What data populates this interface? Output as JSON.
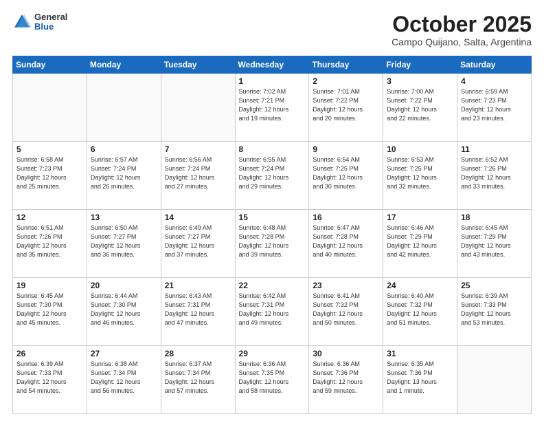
{
  "header": {
    "logo_general": "General",
    "logo_blue": "Blue",
    "title": "October 2025",
    "subtitle": "Campo Quijano, Salta, Argentina"
  },
  "weekdays": [
    "Sunday",
    "Monday",
    "Tuesday",
    "Wednesday",
    "Thursday",
    "Friday",
    "Saturday"
  ],
  "weeks": [
    [
      {
        "day": "",
        "info": ""
      },
      {
        "day": "",
        "info": ""
      },
      {
        "day": "",
        "info": ""
      },
      {
        "day": "1",
        "info": "Sunrise: 7:02 AM\nSunset: 7:21 PM\nDaylight: 12 hours\nand 19 minutes."
      },
      {
        "day": "2",
        "info": "Sunrise: 7:01 AM\nSunset: 7:22 PM\nDaylight: 12 hours\nand 20 minutes."
      },
      {
        "day": "3",
        "info": "Sunrise: 7:00 AM\nSunset: 7:22 PM\nDaylight: 12 hours\nand 22 minutes."
      },
      {
        "day": "4",
        "info": "Sunrise: 6:59 AM\nSunset: 7:23 PM\nDaylight: 12 hours\nand 23 minutes."
      }
    ],
    [
      {
        "day": "5",
        "info": "Sunrise: 6:58 AM\nSunset: 7:23 PM\nDaylight: 12 hours\nand 25 minutes."
      },
      {
        "day": "6",
        "info": "Sunrise: 6:57 AM\nSunset: 7:24 PM\nDaylight: 12 hours\nand 26 minutes."
      },
      {
        "day": "7",
        "info": "Sunrise: 6:56 AM\nSunset: 7:24 PM\nDaylight: 12 hours\nand 27 minutes."
      },
      {
        "day": "8",
        "info": "Sunrise: 6:55 AM\nSunset: 7:24 PM\nDaylight: 12 hours\nand 29 minutes."
      },
      {
        "day": "9",
        "info": "Sunrise: 6:54 AM\nSunset: 7:25 PM\nDaylight: 12 hours\nand 30 minutes."
      },
      {
        "day": "10",
        "info": "Sunrise: 6:53 AM\nSunset: 7:25 PM\nDaylight: 12 hours\nand 32 minutes."
      },
      {
        "day": "11",
        "info": "Sunrise: 6:52 AM\nSunset: 7:26 PM\nDaylight: 12 hours\nand 33 minutes."
      }
    ],
    [
      {
        "day": "12",
        "info": "Sunrise: 6:51 AM\nSunset: 7:26 PM\nDaylight: 12 hours\nand 35 minutes."
      },
      {
        "day": "13",
        "info": "Sunrise: 6:50 AM\nSunset: 7:27 PM\nDaylight: 12 hours\nand 36 minutes."
      },
      {
        "day": "14",
        "info": "Sunrise: 6:49 AM\nSunset: 7:27 PM\nDaylight: 12 hours\nand 37 minutes."
      },
      {
        "day": "15",
        "info": "Sunrise: 6:48 AM\nSunset: 7:28 PM\nDaylight: 12 hours\nand 39 minutes."
      },
      {
        "day": "16",
        "info": "Sunrise: 6:47 AM\nSunset: 7:28 PM\nDaylight: 12 hours\nand 40 minutes."
      },
      {
        "day": "17",
        "info": "Sunrise: 6:46 AM\nSunset: 7:29 PM\nDaylight: 12 hours\nand 42 minutes."
      },
      {
        "day": "18",
        "info": "Sunrise: 6:45 AM\nSunset: 7:29 PM\nDaylight: 12 hours\nand 43 minutes."
      }
    ],
    [
      {
        "day": "19",
        "info": "Sunrise: 6:45 AM\nSunset: 7:30 PM\nDaylight: 12 hours\nand 45 minutes."
      },
      {
        "day": "20",
        "info": "Sunrise: 6:44 AM\nSunset: 7:30 PM\nDaylight: 12 hours\nand 46 minutes."
      },
      {
        "day": "21",
        "info": "Sunrise: 6:43 AM\nSunset: 7:31 PM\nDaylight: 12 hours\nand 47 minutes."
      },
      {
        "day": "22",
        "info": "Sunrise: 6:42 AM\nSunset: 7:31 PM\nDaylight: 12 hours\nand 49 minutes."
      },
      {
        "day": "23",
        "info": "Sunrise: 6:41 AM\nSunset: 7:32 PM\nDaylight: 12 hours\nand 50 minutes."
      },
      {
        "day": "24",
        "info": "Sunrise: 6:40 AM\nSunset: 7:32 PM\nDaylight: 12 hours\nand 51 minutes."
      },
      {
        "day": "25",
        "info": "Sunrise: 6:39 AM\nSunset: 7:33 PM\nDaylight: 12 hours\nand 53 minutes."
      }
    ],
    [
      {
        "day": "26",
        "info": "Sunrise: 6:39 AM\nSunset: 7:33 PM\nDaylight: 12 hours\nand 54 minutes."
      },
      {
        "day": "27",
        "info": "Sunrise: 6:38 AM\nSunset: 7:34 PM\nDaylight: 12 hours\nand 56 minutes."
      },
      {
        "day": "28",
        "info": "Sunrise: 6:37 AM\nSunset: 7:34 PM\nDaylight: 12 hours\nand 57 minutes."
      },
      {
        "day": "29",
        "info": "Sunrise: 6:36 AM\nSunset: 7:35 PM\nDaylight: 12 hours\nand 58 minutes."
      },
      {
        "day": "30",
        "info": "Sunrise: 6:36 AM\nSunset: 7:36 PM\nDaylight: 12 hours\nand 59 minutes."
      },
      {
        "day": "31",
        "info": "Sunrise: 6:35 AM\nSunset: 7:36 PM\nDaylight: 13 hours\nand 1 minute."
      },
      {
        "day": "",
        "info": ""
      }
    ]
  ]
}
